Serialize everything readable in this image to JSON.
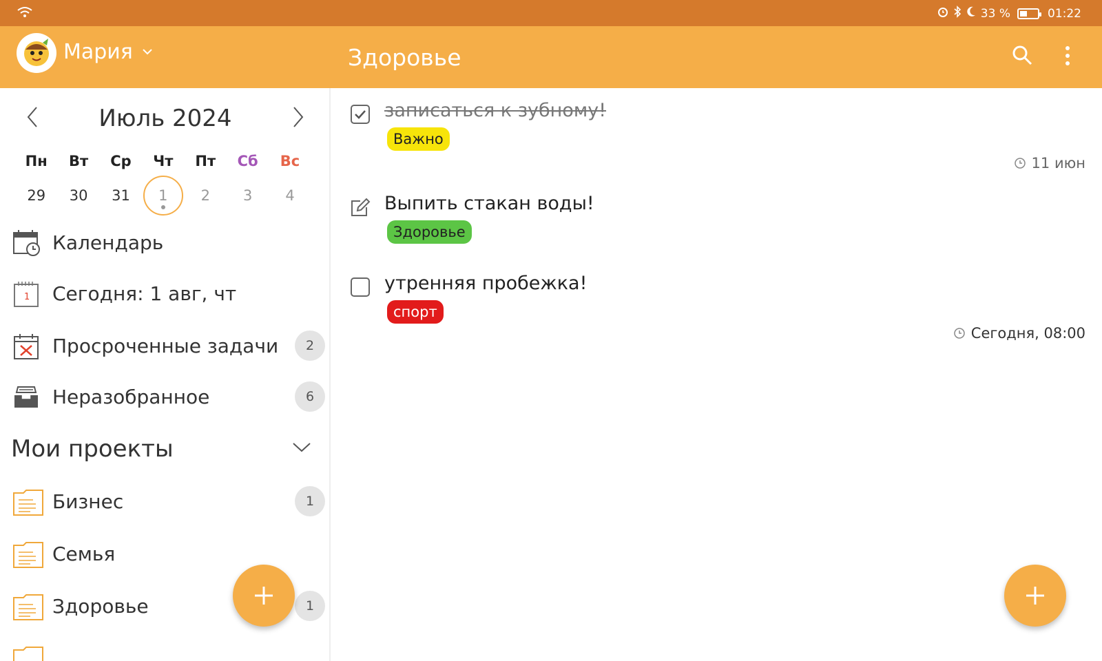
{
  "status_bar": {
    "battery": "33 %",
    "time": "01:22"
  },
  "app_bar": {
    "user_name": "Мария",
    "title": "Здоровье"
  },
  "calendar": {
    "month_title": "Июль 2024",
    "weekdays": [
      "Пн",
      "Вт",
      "Ср",
      "Чт",
      "Пт",
      "Сб",
      "Вс"
    ],
    "days": [
      "29",
      "30",
      "31",
      "1",
      "2",
      "3",
      "4"
    ]
  },
  "sidebar": {
    "nav": [
      {
        "label": "Календарь",
        "badge": ""
      },
      {
        "label": "Сегодня: 1 авг, чт",
        "badge": "",
        "icon_day": "1"
      },
      {
        "label": "Просроченные задачи",
        "badge": "2"
      },
      {
        "label": "Неразобранное",
        "badge": "6"
      }
    ],
    "projects_title": "Мои проекты",
    "projects": [
      {
        "label": "Бизнес",
        "badge": "1"
      },
      {
        "label": "Семья",
        "badge": ""
      },
      {
        "label": "Здоровье",
        "badge": "1"
      }
    ]
  },
  "tasks": [
    {
      "title": "записаться к зубному!",
      "tag": "Важно",
      "tag_color": "#f7e40a",
      "meta": "11 июн",
      "done": true
    },
    {
      "title": "Выпить стакан воды!",
      "tag": "Здоровье",
      "tag_color": "#5cc545",
      "meta": ""
    },
    {
      "title": "утренняя пробежка!",
      "tag": "спорт",
      "tag_color": "#e21b1b",
      "meta": "Сегодня, 08:00"
    }
  ],
  "colors": {
    "accent": "#f5ae48",
    "status_bar": "#d57a2c"
  }
}
